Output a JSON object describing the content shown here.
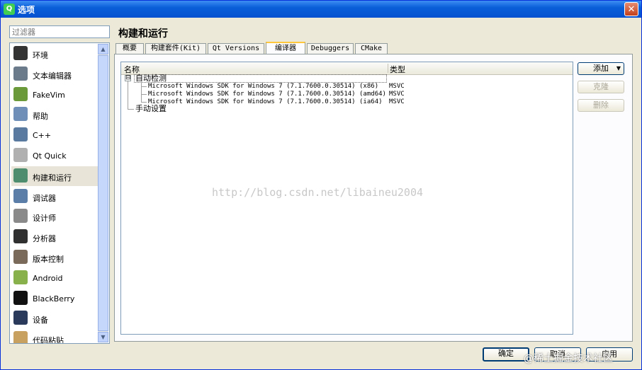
{
  "window": {
    "title": "选项",
    "app_icon": "qt-icon",
    "close_icon": "close-icon"
  },
  "filter": {
    "placeholder": "过滤器"
  },
  "sidebar": {
    "items": [
      {
        "label": "环境",
        "icon": "monitor-icon",
        "color": "#333333"
      },
      {
        "label": "文本编辑器",
        "icon": "text-editor-icon",
        "color": "#6b7b8c"
      },
      {
        "label": "FakeVim",
        "icon": "fakevim-icon",
        "color": "#6a9a3a"
      },
      {
        "label": "帮助",
        "icon": "help-icon",
        "color": "#6f8fb8"
      },
      {
        "label": "C++",
        "icon": "braces-icon",
        "color": "#5a7aa0"
      },
      {
        "label": "Qt Quick",
        "icon": "paper-plane-icon",
        "color": "#b0b0b0"
      },
      {
        "label": "构建和运行",
        "icon": "build-run-icon",
        "color": "#4e8e6e"
      },
      {
        "label": "调试器",
        "icon": "debugger-icon",
        "color": "#5a7ea8"
      },
      {
        "label": "设计师",
        "icon": "designer-icon",
        "color": "#8a8a8a"
      },
      {
        "label": "分析器",
        "icon": "analyzer-icon",
        "color": "#303030"
      },
      {
        "label": "版本控制",
        "icon": "version-control-icon",
        "color": "#7a6a5a"
      },
      {
        "label": "Android",
        "icon": "android-icon",
        "color": "#88b04b"
      },
      {
        "label": "BlackBerry",
        "icon": "blackberry-icon",
        "color": "#111111"
      },
      {
        "label": "设备",
        "icon": "device-icon",
        "color": "#2a3a5a"
      },
      {
        "label": "代码粘贴",
        "icon": "code-paste-icon",
        "color": "#c8a060"
      }
    ],
    "selected_index": 6
  },
  "page": {
    "title": "构建和运行"
  },
  "tabs": [
    {
      "label": "概要"
    },
    {
      "label": "构建套件(Kit)"
    },
    {
      "label": "Qt Versions"
    },
    {
      "label": "编译器"
    },
    {
      "label": "Debuggers"
    },
    {
      "label": "CMake"
    }
  ],
  "active_tab": 3,
  "tree": {
    "columns": [
      "名称",
      "类型"
    ],
    "groups": [
      {
        "label": "自动检测",
        "expanded": true,
        "expander": "⊟",
        "children": [
          {
            "name": "Microsoft Windows SDK for Windows 7 (7.1.7600.0.30514) (x86)",
            "type": "MSVC"
          },
          {
            "name": "Microsoft Windows SDK for Windows 7 (7.1.7600.0.30514) (amd64)",
            "type": "MSVC"
          },
          {
            "name": "Microsoft Windows SDK for Windows 7 (7.1.7600.0.30514) (ia64)",
            "type": "MSVC"
          }
        ]
      },
      {
        "label": "手动设置",
        "children": []
      }
    ]
  },
  "side_buttons": {
    "add": "添加",
    "clone": "克隆",
    "remove": "删除"
  },
  "footer": {
    "ok": "确定",
    "cancel": "取消",
    "apply": "应用"
  },
  "watermark": "http://blog.csdn.net/libaineu2004",
  "corner_watermark": "@稀土掘金技术社区"
}
